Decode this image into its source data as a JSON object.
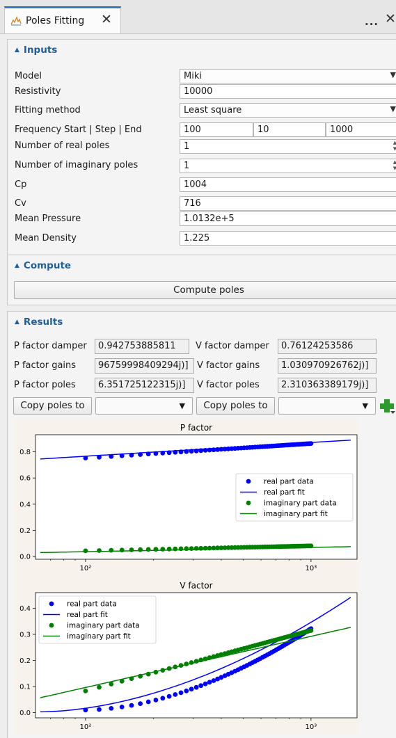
{
  "tab": {
    "title": "Poles Fitting",
    "close": "✕",
    "more": "...",
    "close2": "✕",
    "icon": "chart-icon"
  },
  "inputs": {
    "header": "Inputs",
    "model_label": "Model",
    "model_value": "Miki",
    "resistivity_label": "Resistivity",
    "resistivity_value": "10000",
    "fitting_label": "Fitting method",
    "fitting_value": "Least square",
    "freq_label": "Frequency Start | Step | End",
    "freq_start": "100",
    "freq_step": "10",
    "freq_end": "1000",
    "real_poles_label": "Number of real poles",
    "real_poles_value": "1",
    "imag_poles_label": "Number of imaginary poles",
    "imag_poles_value": "1",
    "cp_label": "Cp",
    "cp_value": "1004",
    "cv_label": "Cv",
    "cv_value": "716",
    "pressure_label": "Mean Pressure",
    "pressure_value": "1.0132e+5",
    "density_label": "Mean Density",
    "density_value": "1.225"
  },
  "compute": {
    "header": "Compute",
    "button": "Compute poles"
  },
  "results": {
    "header": "Results",
    "p_damper_label": "P factor damper",
    "p_damper_value": "0.942753885811",
    "v_damper_label": "V factor damper",
    "v_damper_value": "0.76124253586",
    "p_gains_label": "P factor gains",
    "p_gains_value": "96759998409294j)]",
    "v_gains_label": "V factor gains",
    "v_gains_value": "1.030970926762j)]",
    "p_poles_label": "P factor poles",
    "p_poles_value": "6.351725122315j)]",
    "v_poles_label": "V factor poles",
    "v_poles_value": "2.310363389179j)]",
    "copy_label_1": "Copy poles to",
    "copy_label_2": "Copy poles to"
  },
  "chart_data": [
    {
      "type": "line",
      "title": "P factor",
      "xscale": "log",
      "xlim": [
        60,
        1600
      ],
      "ylim": [
        -0.02,
        0.93
      ],
      "xticks": [
        "10²",
        "10³"
      ],
      "yticks": [
        "0.0",
        "0.2",
        "0.4",
        "0.6",
        "0.8"
      ],
      "legend_position": "center-right",
      "series": [
        {
          "name": "real part data",
          "style": "markers",
          "color": "#0000ff",
          "x_range": [
            100,
            1000
          ],
          "y": [
            0.752,
            0.863
          ]
        },
        {
          "name": "real part fit",
          "style": "line",
          "color": "#0000ff",
          "x_range": [
            63,
            1500
          ],
          "y": [
            0.745,
            0.889
          ]
        },
        {
          "name": "imaginary part data",
          "style": "markers",
          "color": "#008000",
          "x_range": [
            100,
            1000
          ],
          "y": [
            0.044,
            0.082
          ]
        },
        {
          "name": "imaginary part fit",
          "style": "line",
          "color": "#008000",
          "x_range": [
            63,
            1500
          ],
          "y": [
            0.031,
            0.076
          ]
        }
      ]
    },
    {
      "type": "line",
      "title": "V factor",
      "xscale": "log",
      "xlim": [
        60,
        1600
      ],
      "ylim": [
        -0.02,
        0.46
      ],
      "xticks": [
        "10²",
        "10³"
      ],
      "yticks": [
        "0.0",
        "0.1",
        "0.2",
        "0.3",
        "0.4"
      ],
      "legend_position": "top-left",
      "series": [
        {
          "name": "real part data",
          "style": "markers",
          "color": "#0000ff",
          "x_range": [
            100,
            1000
          ],
          "y": [
            0.01,
            0.322
          ]
        },
        {
          "name": "real part fit",
          "style": "line",
          "color": "#0000ff",
          "x_range": [
            63,
            1500
          ],
          "y": [
            0.003,
            0.442
          ]
        },
        {
          "name": "imaginary part data",
          "style": "markers",
          "color": "#008000",
          "x_range": [
            100,
            1000
          ],
          "y": [
            0.083,
            0.315
          ]
        },
        {
          "name": "imaginary part fit",
          "style": "line",
          "color": "#008000",
          "x_range": [
            63,
            1500
          ],
          "y": [
            0.057,
            0.327
          ]
        }
      ]
    }
  ]
}
